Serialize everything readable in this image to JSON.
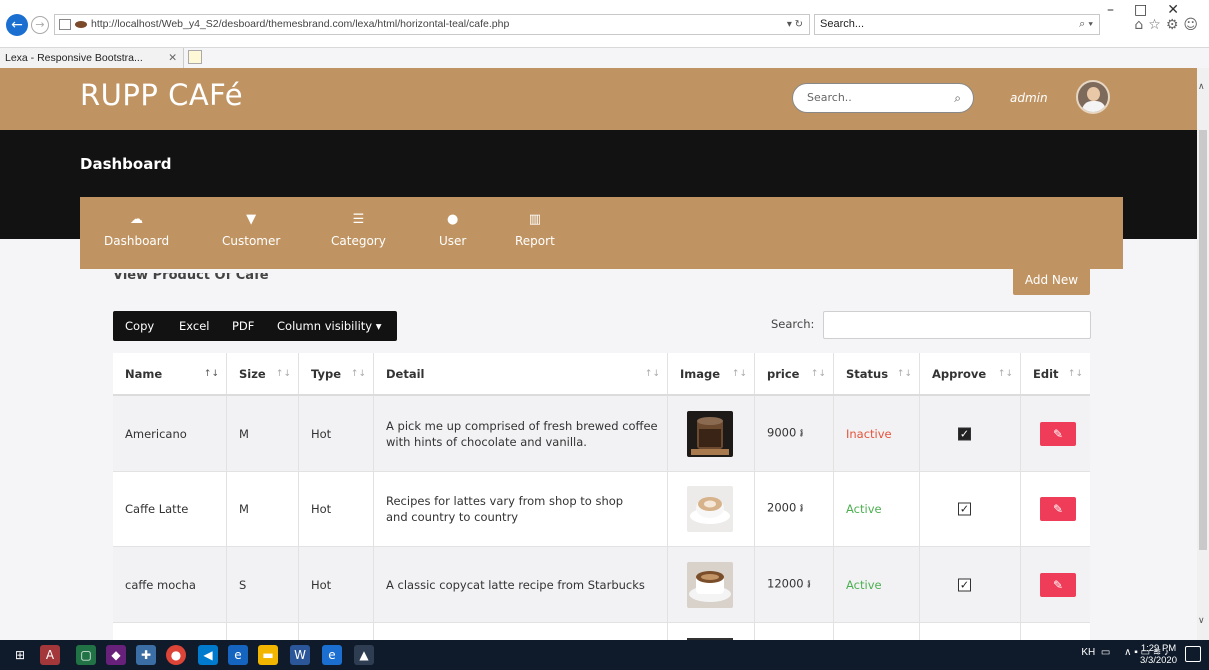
{
  "browser": {
    "url": "http://localhost/Web_y4_S2/desboard/themesbrand.com/lexa/html/horizontal-teal/cafe.php",
    "search_placeholder": "Search...",
    "tab_title": "Lexa - Responsive Bootstra..."
  },
  "header": {
    "brand": "RUPP CAFé",
    "search_placeholder": "Search..",
    "user": "admin"
  },
  "page_title": "Dashboard",
  "menu": [
    {
      "label": "Dashboard",
      "icon": "dashboard-icon"
    },
    {
      "label": "Customer",
      "icon": "customer-icon"
    },
    {
      "label": "Category",
      "icon": "list-icon"
    },
    {
      "label": "User",
      "icon": "user-gear-icon"
    },
    {
      "label": "Report",
      "icon": "bar-chart-icon"
    }
  ],
  "card": {
    "title": "View Product Of Cafe",
    "add_button": "Add New"
  },
  "toolbar": {
    "copy": "Copy",
    "excel": "Excel",
    "pdf": "PDF",
    "colvis": "Column visibility ▾",
    "search_label": "Search:"
  },
  "table": {
    "headers": [
      "Name",
      "Size",
      "Type",
      "Detail",
      "Image",
      "price",
      "Status",
      "Approve",
      "Edit"
    ],
    "rows": [
      {
        "name": "Americano",
        "size": "M",
        "type": "Hot",
        "detail": "A pick me up comprised of fresh brewed coffee with hints of chocolate and vanilla.",
        "price": "9000 ៛",
        "status": "Inactive",
        "approved": true
      },
      {
        "name": "Caffe Latte",
        "size": "M",
        "type": "Hot",
        "detail": "Recipes for lattes vary from shop to shop and country to country",
        "price": "2000 ៛",
        "status": "Active",
        "approved": true
      },
      {
        "name": "caffe mocha",
        "size": "S",
        "type": "Hot",
        "detail": "A classic copycat latte recipe from Starbucks",
        "price": "12000 ៛",
        "status": "Active",
        "approved": true
      }
    ]
  },
  "taskbar": {
    "lang": "KH",
    "time": "1:29 PM",
    "date": "3/3/2020"
  },
  "colors": {
    "brand": "#c09462",
    "dark": "#121212",
    "edit": "#ef3d59",
    "active": "#4caf50",
    "inactive": "#e5533a"
  }
}
